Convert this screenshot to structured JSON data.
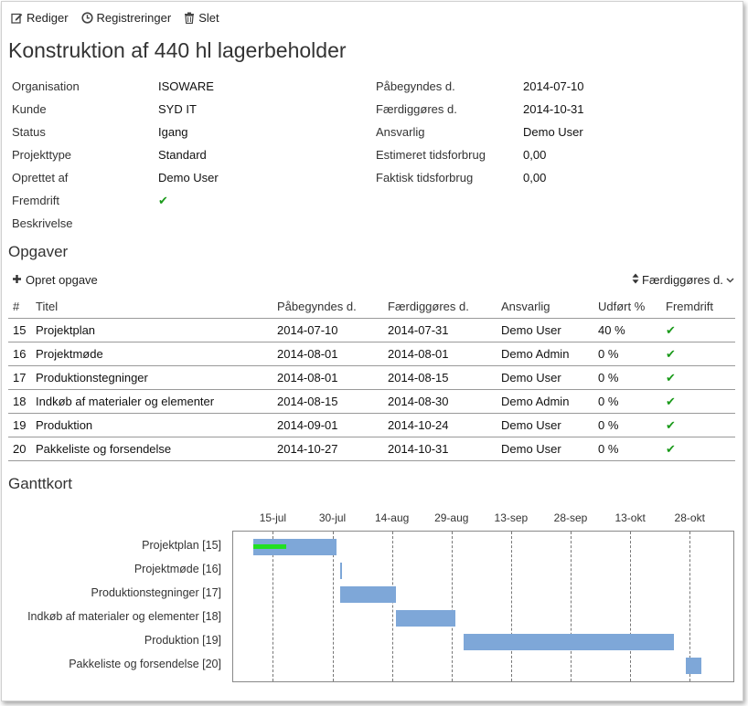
{
  "toolbar": {
    "edit_label": "Rediger",
    "registrations_label": "Registreringer",
    "delete_label": "Slet"
  },
  "project": {
    "title": "Konstruktion af 440 hl lagerbeholder",
    "left_fields": [
      {
        "label": "Organisation",
        "value": "ISOWARE"
      },
      {
        "label": "Kunde",
        "value": "SYD IT"
      },
      {
        "label": "Status",
        "value": "Igang"
      },
      {
        "label": "Projekttype",
        "value": "Standard"
      },
      {
        "label": "Oprettet af",
        "value": "Demo User"
      },
      {
        "label": "Fremdrift",
        "value": "✔"
      },
      {
        "label": "Beskrivelse",
        "value": ""
      }
    ],
    "right_fields": [
      {
        "label": "Påbegyndes d.",
        "value": "2014-07-10"
      },
      {
        "label": "Færdiggøres d.",
        "value": "2014-10-31"
      },
      {
        "label": "Ansvarlig",
        "value": "Demo User"
      },
      {
        "label": "Estimeret tidsforbrug",
        "value": "0,00"
      },
      {
        "label": "Faktisk tidsforbrug",
        "value": "0,00"
      }
    ]
  },
  "tasks_section": {
    "heading": "Opgaver",
    "create_label": "Opret opgave",
    "sort_label": "Færdiggøres d.",
    "columns": [
      "#",
      "Titel",
      "Påbegyndes d.",
      "Færdiggøres d.",
      "Ansvarlig",
      "Udført %",
      "Fremdrift"
    ],
    "rows": [
      {
        "id": "15",
        "title": "Projektplan",
        "start": "2014-07-10",
        "end": "2014-07-31",
        "owner": "Demo User",
        "done": "40 %",
        "progress": "✔"
      },
      {
        "id": "16",
        "title": "Projektmøde",
        "start": "2014-08-01",
        "end": "2014-08-01",
        "owner": "Demo Admin",
        "done": "0 %",
        "progress": "✔"
      },
      {
        "id": "17",
        "title": "Produktionstegninger",
        "start": "2014-08-01",
        "end": "2014-08-15",
        "owner": "Demo User",
        "done": "0 %",
        "progress": "✔"
      },
      {
        "id": "18",
        "title": "Indkøb af materialer og elementer",
        "start": "2014-08-15",
        "end": "2014-08-30",
        "owner": "Demo Admin",
        "done": "0 %",
        "progress": "✔"
      },
      {
        "id": "19",
        "title": "Produktion",
        "start": "2014-09-01",
        "end": "2014-10-24",
        "owner": "Demo User",
        "done": "0 %",
        "progress": "✔"
      },
      {
        "id": "20",
        "title": "Pakkeliste og forsendelse",
        "start": "2014-10-27",
        "end": "2014-10-31",
        "owner": "Demo User",
        "done": "0 %",
        "progress": "✔"
      }
    ]
  },
  "gantt": {
    "heading": "Ganttkort",
    "tick_labels": [
      "15-jul",
      "30-jul",
      "14-aug",
      "29-aug",
      "13-sep",
      "28-sep",
      "13-okt",
      "28-okt"
    ],
    "tick_dates": [
      "2014-07-15",
      "2014-07-30",
      "2014-08-14",
      "2014-08-29",
      "2014-09-13",
      "2014-09-28",
      "2014-10-13",
      "2014-10-28"
    ],
    "axis_start": "2014-07-05",
    "axis_end": "2014-11-08",
    "row_labels": [
      "Projektplan [15]",
      "Projektmøde [16]",
      "Produktionstegninger [17]",
      "Indkøb af materialer og elementer [18]",
      "Produktion [19]",
      "Pakkeliste og forsendelse [20]"
    ],
    "bars": [
      {
        "start": "2014-07-10",
        "end": "2014-07-31",
        "progress": 0.4
      },
      {
        "start": "2014-08-01",
        "end": "2014-08-01",
        "progress": 0
      },
      {
        "start": "2014-08-01",
        "end": "2014-08-15",
        "progress": 0
      },
      {
        "start": "2014-08-15",
        "end": "2014-08-30",
        "progress": 0
      },
      {
        "start": "2014-09-01",
        "end": "2014-10-24",
        "progress": 0
      },
      {
        "start": "2014-10-27",
        "end": "2014-10-31",
        "progress": 0
      }
    ],
    "bar_color": "#7ea7d8",
    "progress_color": "#22e022"
  },
  "colors": {
    "check": "#1a9a1a"
  }
}
